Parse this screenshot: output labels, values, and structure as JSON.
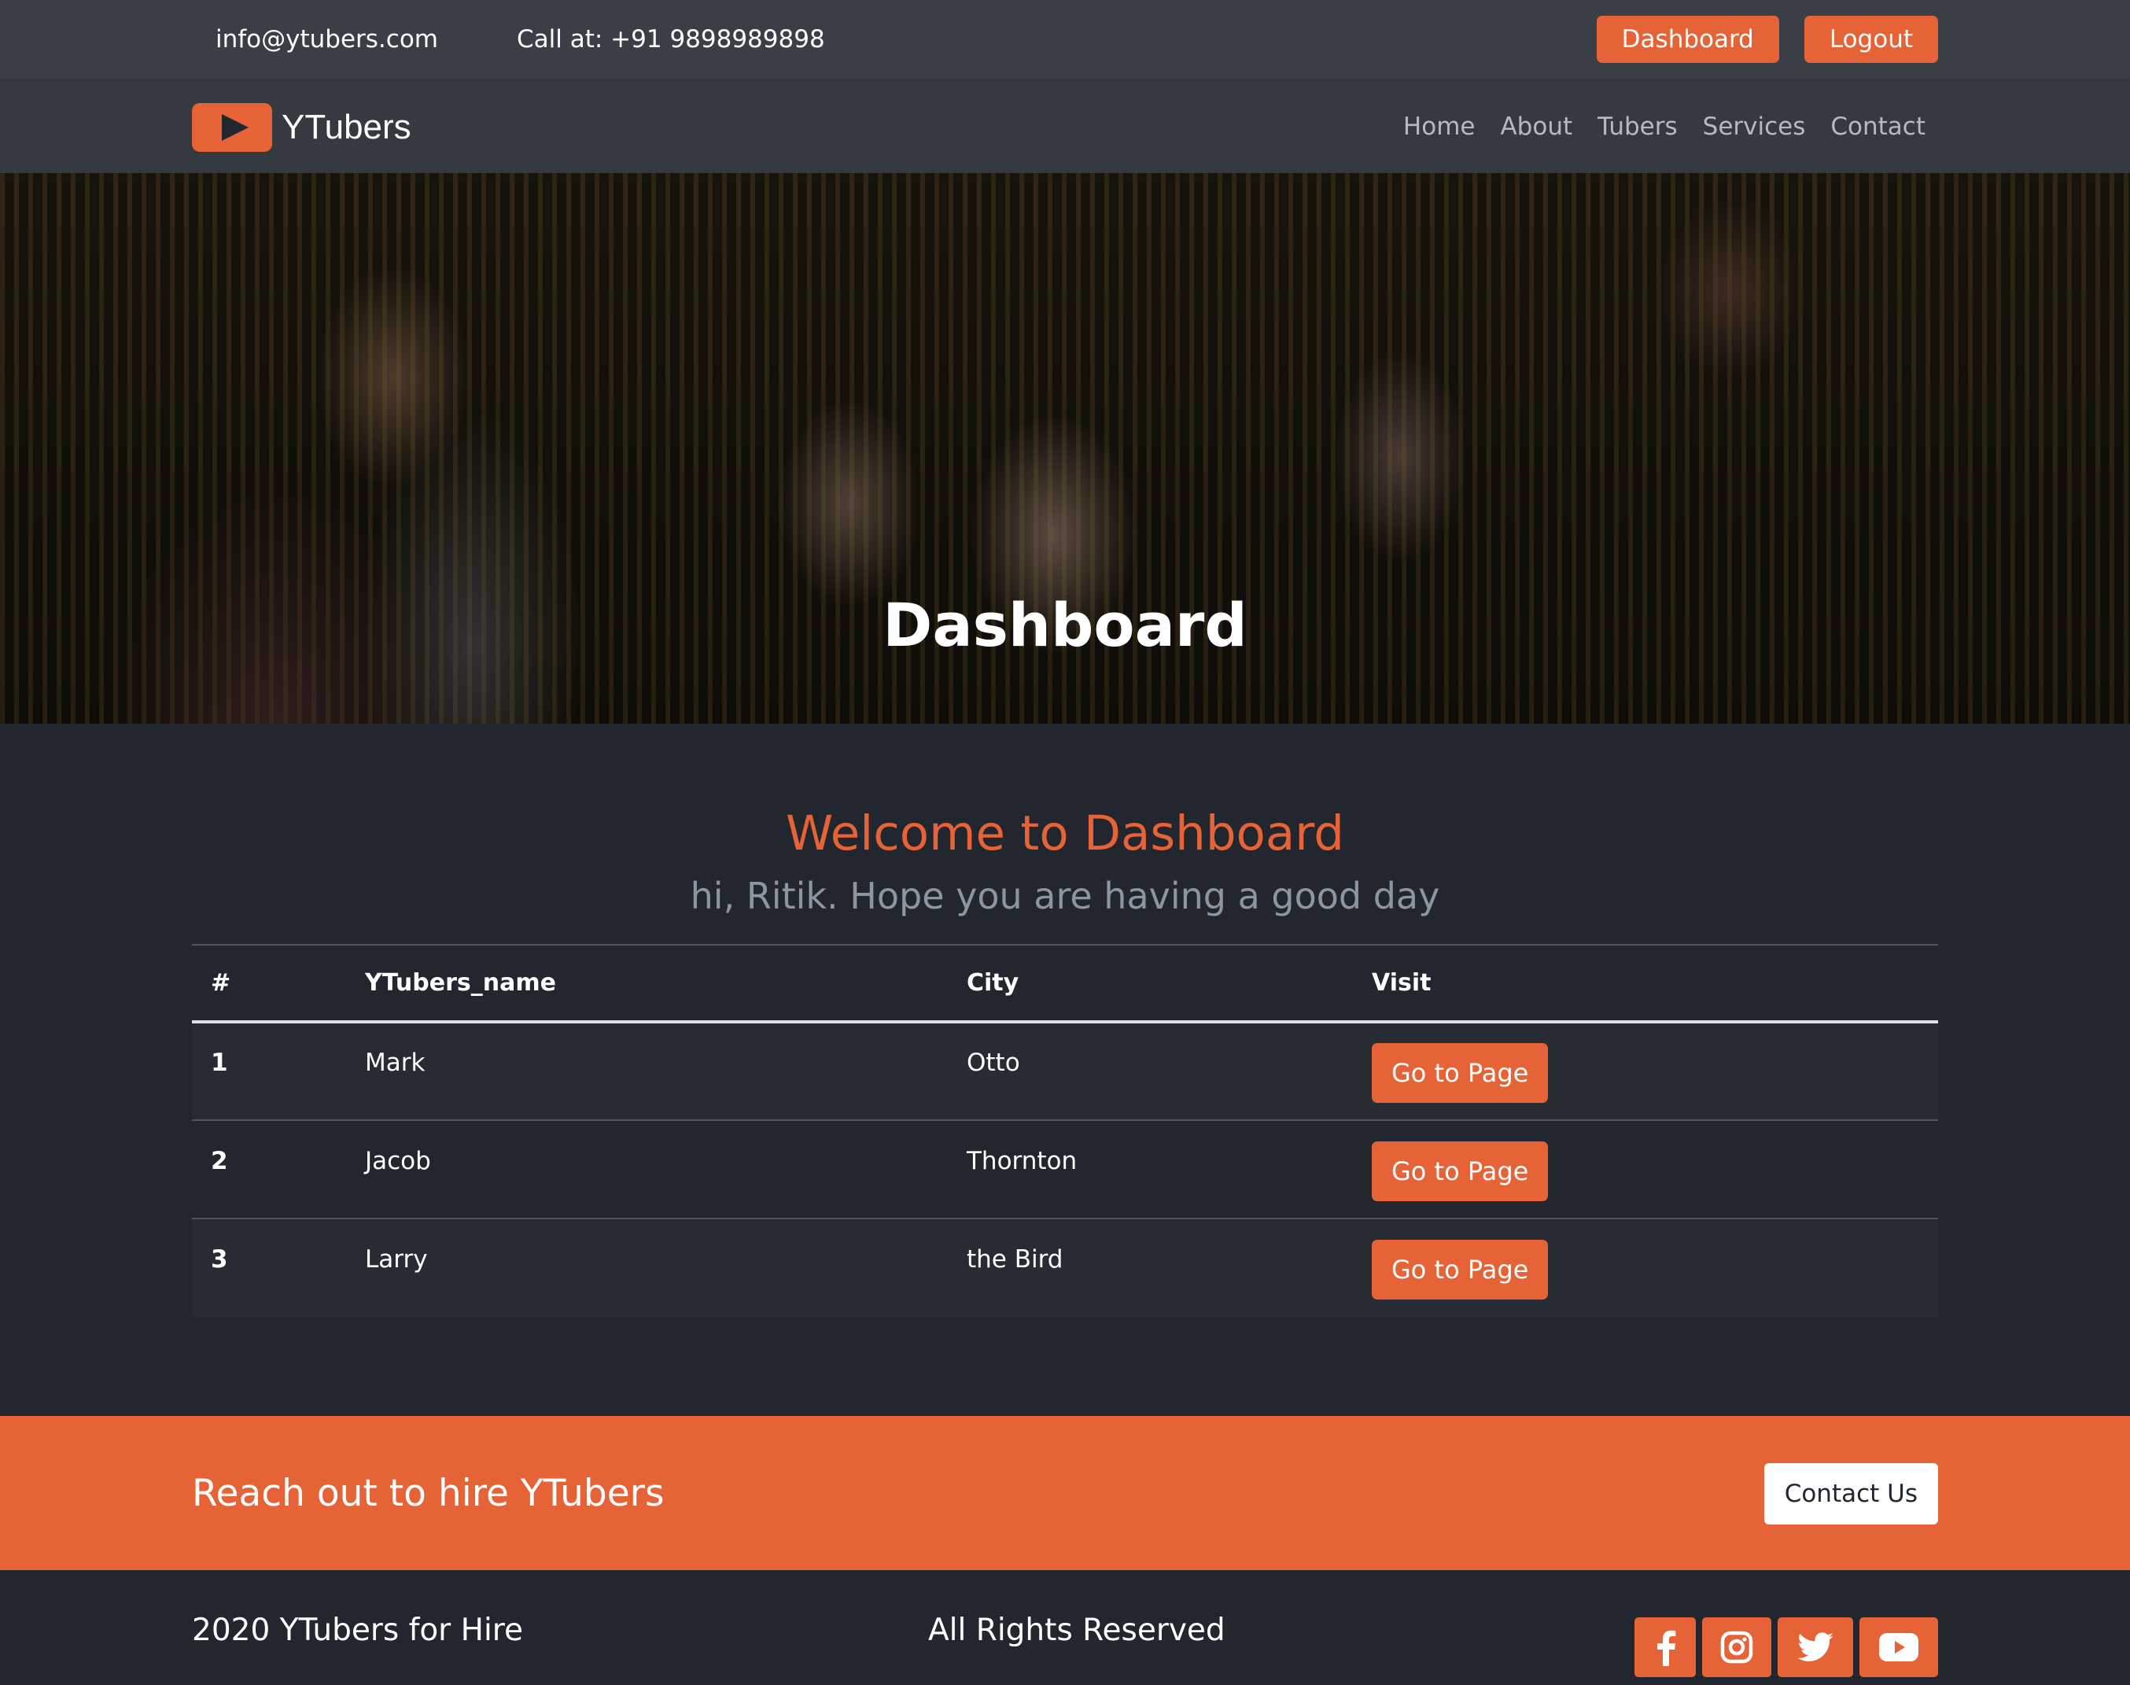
{
  "topbar": {
    "email": "info@ytubers.com",
    "phone": "Call at: +91 9898989898",
    "dashboard_label": "Dashboard",
    "logout_label": "Logout"
  },
  "navbar": {
    "brand": "YTubers",
    "links": [
      "Home",
      "About",
      "Tubers",
      "Services",
      "Contact"
    ]
  },
  "hero": {
    "title": "Dashboard"
  },
  "main": {
    "welcome": "Welcome to Dashboard",
    "greeting": "hi, Ritik. Hope you are having a good day",
    "table": {
      "headers": [
        "#",
        "YTubers_name",
        "City",
        "Visit"
      ],
      "rows": [
        {
          "index": "1",
          "name": "Mark",
          "city": "Otto",
          "action": "Go to Page"
        },
        {
          "index": "2",
          "name": "Jacob",
          "city": "Thornton",
          "action": "Go to Page"
        },
        {
          "index": "3",
          "name": "Larry",
          "city": "the Bird",
          "action": "Go to Page"
        }
      ]
    }
  },
  "cta": {
    "title": "Reach out to hire YTubers",
    "button": "Contact Us"
  },
  "footer": {
    "copyright": "2020 YTubers for Hire",
    "rights": "All Rights Reserved",
    "social_icons": [
      "facebook-icon",
      "instagram-icon",
      "twitter-icon",
      "youtube-icon"
    ]
  },
  "colors": {
    "accent": "#e56336",
    "background": "#22262f",
    "topbar": "#393e47",
    "navbar": "#353940"
  }
}
